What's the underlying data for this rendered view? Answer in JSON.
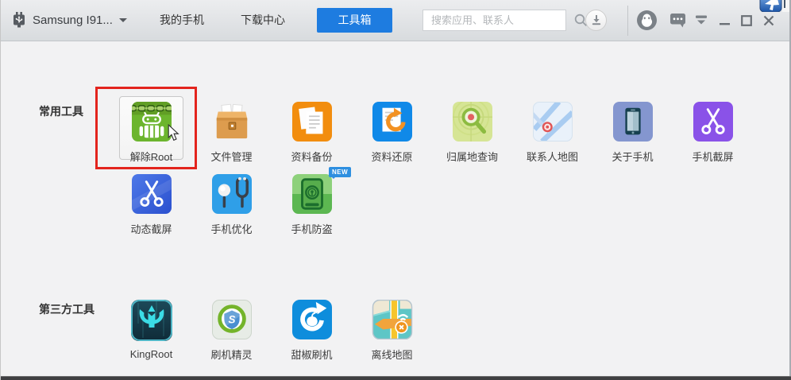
{
  "titlebar": {
    "device": {
      "label": "Samsung I91...",
      "icon": "usb-phone-icon"
    },
    "tabs": [
      {
        "label": "我的手机",
        "active": false
      },
      {
        "label": "下载中心",
        "active": false
      },
      {
        "label": "工具箱",
        "active": true
      }
    ],
    "search": {
      "placeholder": "搜索应用、联系人",
      "value": "",
      "icon": "search-icon"
    },
    "action_icons": [
      "download-icon",
      "qq-icon",
      "chat-icon",
      "menu-arrow-icon",
      "minimize-icon",
      "maximize-icon",
      "close-icon"
    ]
  },
  "sections": [
    {
      "title": "常用工具",
      "items": [
        {
          "label": "解除Root",
          "icon": "remove-root-icon",
          "highlighted": true
        },
        {
          "label": "文件管理",
          "icon": "file-manager-icon"
        },
        {
          "label": "资料备份",
          "icon": "data-backup-icon"
        },
        {
          "label": "资料还原",
          "icon": "data-restore-icon"
        },
        {
          "label": "归属地查询",
          "icon": "location-lookup-icon"
        },
        {
          "label": "联系人地图",
          "icon": "contacts-map-icon"
        },
        {
          "label": "关于手机",
          "icon": "about-phone-icon"
        },
        {
          "label": "手机截屏",
          "icon": "phone-screenshot-icon"
        },
        {
          "label": "动态截屏",
          "icon": "dynamic-screenshot-icon"
        },
        {
          "label": "手机优化",
          "icon": "phone-optimize-icon"
        },
        {
          "label": "手机防盗",
          "icon": "phone-antitheft-icon",
          "badge": "NEW"
        }
      ]
    },
    {
      "title": "第三方工具",
      "items": [
        {
          "label": "KingRoot",
          "icon": "kingroot-icon"
        },
        {
          "label": "刷机精灵",
          "icon": "flash-wizard-icon"
        },
        {
          "label": "甜椒刷机",
          "icon": "pepper-flash-icon"
        },
        {
          "label": "离线地图",
          "icon": "offline-map-icon"
        }
      ]
    }
  ],
  "colors": {
    "accent": "#1e7ce0",
    "highlight_border": "#e3241d",
    "badge_bg": "#2e8fe0"
  }
}
